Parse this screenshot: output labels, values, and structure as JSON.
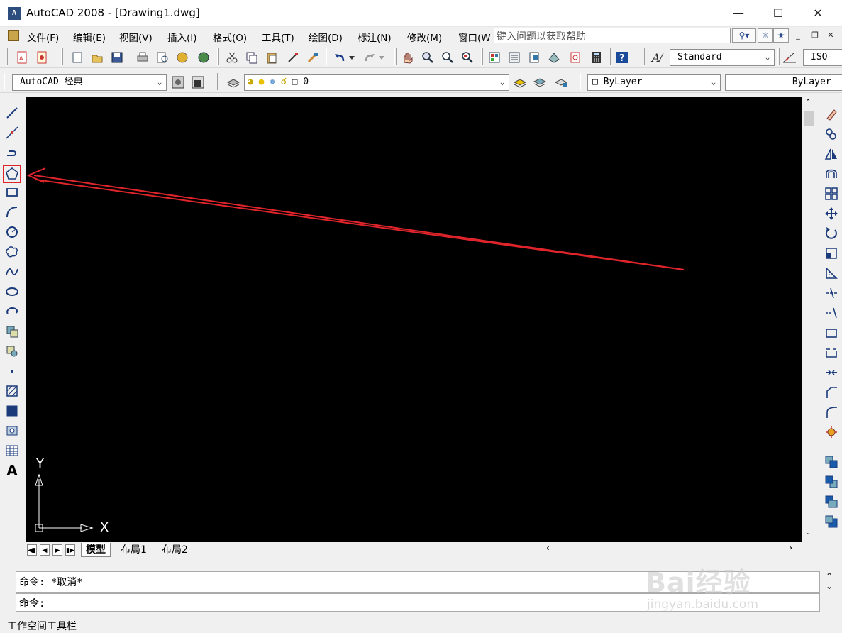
{
  "window": {
    "title": "AutoCAD 2008 - [Drawing1.dwg]",
    "app_icon_text": "A"
  },
  "menubar": {
    "items": [
      {
        "label": "文件(F)"
      },
      {
        "label": "编辑(E)"
      },
      {
        "label": "视图(V)"
      },
      {
        "label": "插入(I)"
      },
      {
        "label": "格式(O)"
      },
      {
        "label": "工具(T)"
      },
      {
        "label": "绘图(D)"
      },
      {
        "label": "标注(N)"
      },
      {
        "label": "修改(M)"
      },
      {
        "label": "窗口(W"
      }
    ],
    "help_placeholder": "键入问题以获取帮助"
  },
  "toolbar_styles": {
    "text_style": "Standard",
    "dim_style": "ISO-"
  },
  "toolbar_layers": {
    "workspace": "AutoCAD 经典",
    "layer_name": "0",
    "color": "ByLayer",
    "linetype": "ByLayer"
  },
  "canvas": {
    "ucs_y_label": "Y",
    "ucs_x_label": "X",
    "annotation_color": "#e0242b"
  },
  "layout_tabs": [
    {
      "label": "模型"
    },
    {
      "label": "布局1"
    },
    {
      "label": "布局2"
    }
  ],
  "command_line": {
    "history": "命令: *取消*",
    "prompt": "命令:"
  },
  "status_bar": {
    "text": "工作空间工具栏"
  },
  "watermark": {
    "brand": "Bai经验",
    "url": "jingyan.baidu.com"
  }
}
